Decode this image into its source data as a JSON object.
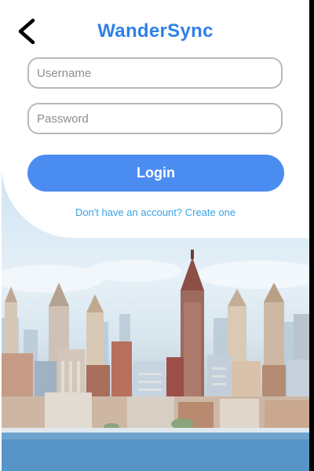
{
  "header": {
    "title": "WanderSync",
    "back_icon": "chevron-left-icon"
  },
  "login_form": {
    "username_placeholder": "Username",
    "username_value": "",
    "password_placeholder": "Password",
    "password_value": "",
    "login_label": "Login",
    "signup_link": "Don't have an account? Create one"
  },
  "colors": {
    "brand": "#2f80e8",
    "button": "#4b8cf0",
    "link": "#3aa0e6",
    "field_border": "#b9b9b9"
  }
}
